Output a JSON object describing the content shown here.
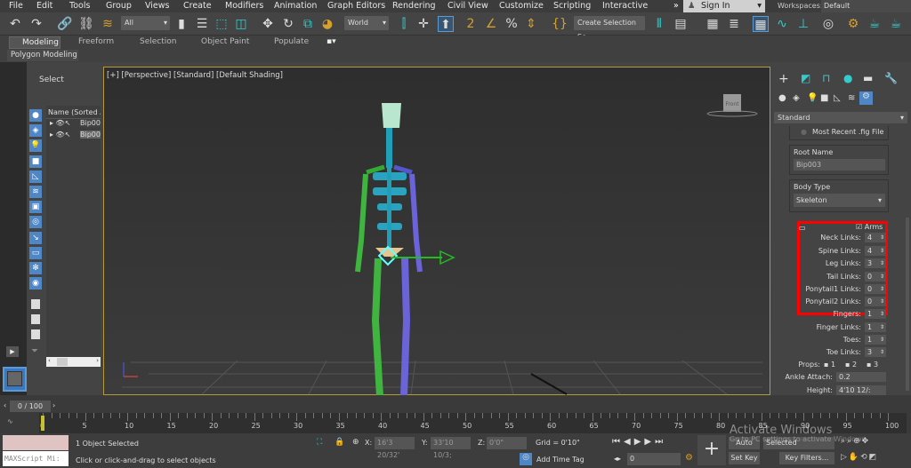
{
  "menu": [
    "File",
    "Edit",
    "Tools",
    "Group",
    "Views",
    "Create",
    "Modifiers",
    "Animation",
    "Graph Editors",
    "Rendering",
    "Civil View",
    "Customize",
    "Scripting",
    "Interactive"
  ],
  "sign_in": "Sign In",
  "workspaces": {
    "label": "Workspaces:",
    "value": "Default"
  },
  "toolbar": {
    "filter": "All",
    "coord": "World",
    "selection_set": "Create Selection Se"
  },
  "ribbon": {
    "tabs": [
      "Modeling",
      "Freeform",
      "Selection",
      "Object Paint",
      "Populate"
    ],
    "active": "Modeling",
    "panel": "Polygon Modeling"
  },
  "explorer": {
    "title": "Select",
    "column": "Name (Sorted A",
    "items": [
      "Bip003",
      "Bip003"
    ]
  },
  "viewport": {
    "label": "[+] [Perspective] [Standard] [Default Shading]",
    "viewcube": "Front"
  },
  "command_panel": {
    "category": "Standard",
    "most_recent": "Most Recent .fig File",
    "root_name_label": "Root Name",
    "root_name": "Bip003",
    "body_type_label": "Body Type",
    "body_type": "Skeleton",
    "arms_label": "Arms",
    "arms_checked": true,
    "params": [
      {
        "label": "Neck Links:",
        "value": "4"
      },
      {
        "label": "Spine Links:",
        "value": "4"
      },
      {
        "label": "Leg Links:",
        "value": "3"
      },
      {
        "label": "Tail Links:",
        "value": "0"
      },
      {
        "label": "Ponytail1 Links:",
        "value": "0"
      },
      {
        "label": "Ponytail2 Links:",
        "value": "0"
      },
      {
        "label": "Fingers:",
        "value": "1"
      },
      {
        "label": "Finger Links:",
        "value": "1"
      },
      {
        "label": "Toes:",
        "value": "1"
      },
      {
        "label": "Toe Links:",
        "value": "3"
      }
    ],
    "props_label": "Props:",
    "props": [
      "1",
      "2",
      "3"
    ],
    "ankle_label": "Ankle Attach:",
    "ankle": "0.2",
    "height_label": "Height:",
    "height": "4'10 12/:"
  },
  "highlight_color": "#ff0000",
  "timeline": {
    "frame": "0 / 100",
    "ticks": [
      "0",
      "5",
      "10",
      "15",
      "20",
      "25",
      "30",
      "35",
      "40",
      "45",
      "50",
      "55",
      "60",
      "65",
      "70",
      "75",
      "80",
      "85",
      "90",
      "95",
      "100"
    ]
  },
  "status": {
    "maxscript": "MAXScript Mi:",
    "selected": "1 Object Selected",
    "prompt": "Click or click-and-drag to select objects",
    "x_label": "X:",
    "x": "16'3 20/32'",
    "y_label": "Y:",
    "y": "33'10 10/3;",
    "z_label": "Z:",
    "z": "0'0\"",
    "grid": "Grid = 0'10\"",
    "add_time_tag": "Add Time Tag",
    "auto_key": "Auto Key",
    "set_key": "Set Key",
    "key_mode": "Selected",
    "key_filters": "Key Filters...",
    "frame_field": "0",
    "watermark1": "Activate Windows",
    "watermark2": "Go to PC settings to activate Windows."
  }
}
